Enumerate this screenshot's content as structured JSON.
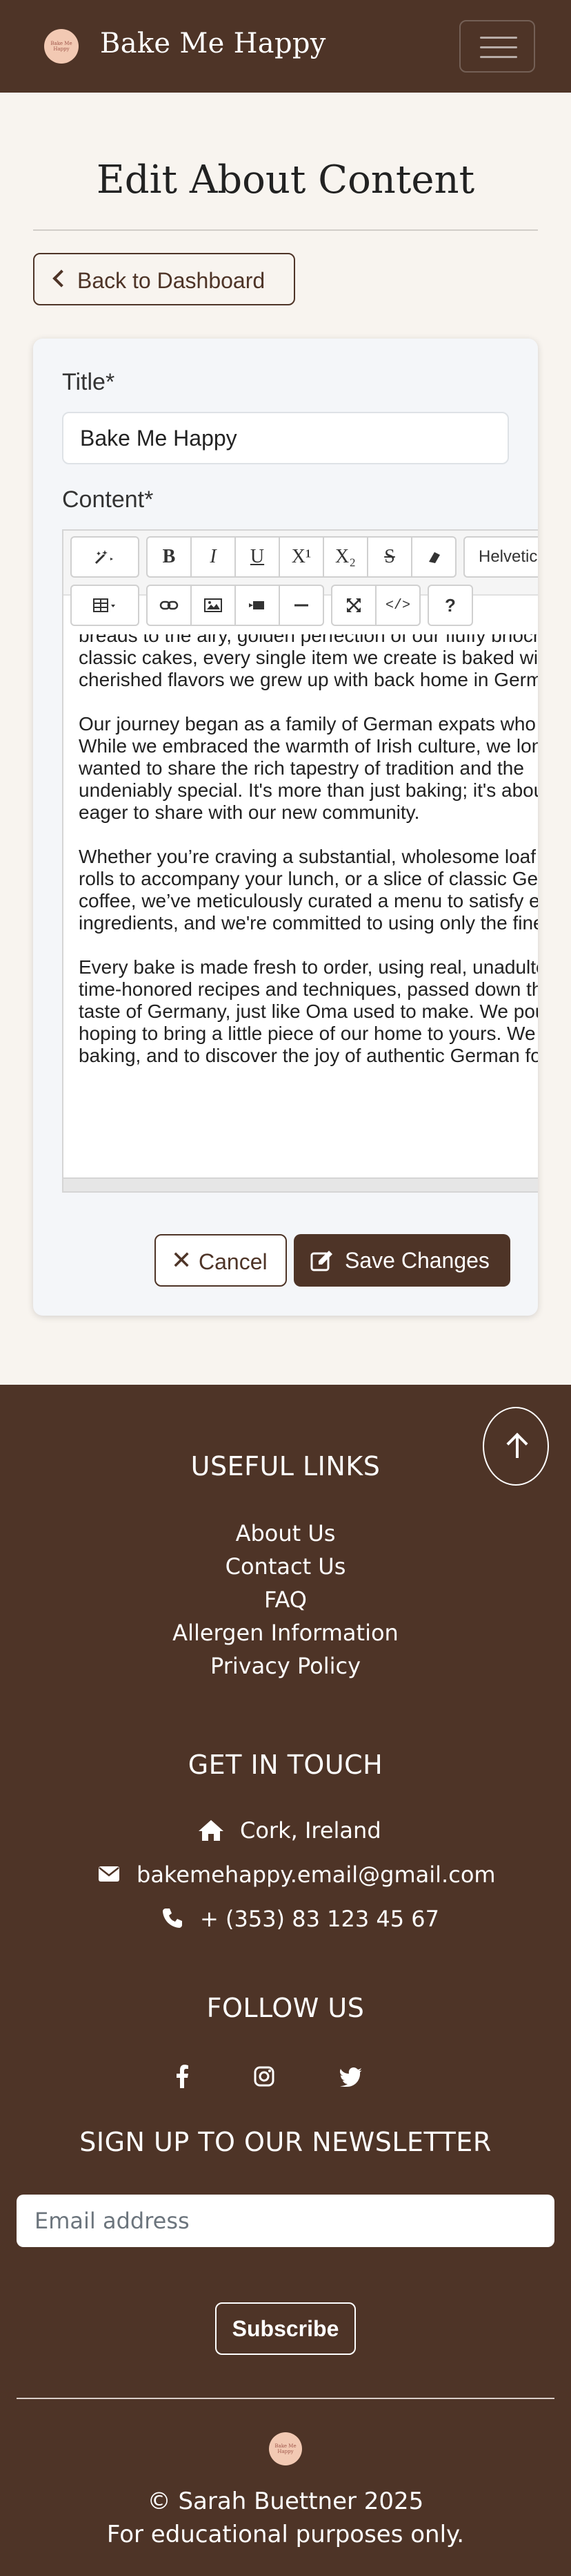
{
  "navbar": {
    "brand": "Bake Me Happy",
    "logo_text": "Bake Me Happy",
    "toggler_icon": "hamburger-icon"
  },
  "page": {
    "title": "Edit About Content",
    "back_label": "Back to Dashboard"
  },
  "form": {
    "title_label": "Title*",
    "title_value": "Bake Me Happy",
    "content_label": "Content*",
    "toolbar": {
      "row1": [
        "magic-icon",
        "B",
        "I",
        "U",
        "X¹",
        "X₂",
        "S",
        "eraser-icon"
      ],
      "font_value": "Helvetica",
      "row2": [
        "table-icon",
        "link-icon",
        "picture-icon",
        "video-icon",
        "hr-icon",
        "fullscreen-icon",
        "</>",
        "?"
      ]
    },
    "content_paragraphs": [
      [
        "breads to the airy, golden perfection of our fluffy brioche",
        "classic cakes, every single item we create is baked with",
        "cherished flavors we grew up with back home in Germany"
      ],
      [
        "Our journey began as a family of German expats who",
        "While we embraced the warmth of Irish culture, we longed",
        "wanted to share the rich tapestry of tradition and the",
        "undeniably special. It's more than just baking; it's about",
        "eager to share with our new community."
      ],
      [
        "Whether you’re craving a substantial, wholesome loaf",
        "rolls to accompany your lunch, or a slice of classic German",
        "coffee, we’ve meticulously curated a menu to satisfy every",
        "ingredients, and we're committed to using only the finest"
      ],
      [
        "Every bake is made fresh to order, using real, unadulterated",
        "time-honored recipes and techniques, passed down through",
        "taste of Germany, just like Oma used to make. We pour",
        "hoping to bring a little piece of our home to yours. We",
        "baking, and to discover the joy of authentic German food"
      ]
    ],
    "cancel_label": "Cancel",
    "save_label": "Save Changes"
  },
  "footer": {
    "useful_links_heading": "USEFUL LINKS",
    "links": [
      "About Us",
      "Contact Us",
      "FAQ",
      "Allergen Information",
      "Privacy Policy"
    ],
    "get_in_touch_heading": "GET IN TOUCH",
    "location": "Cork, Ireland",
    "email": "bakemehappy.email@gmail.com",
    "phone": "+ (353) 83 123 45 67",
    "follow_heading": "FOLLOW US",
    "social": [
      "facebook-icon",
      "instagram-icon",
      "twitter-icon"
    ],
    "newsletter_heading": "SIGN UP TO OUR NEWSLETTER",
    "email_placeholder": "Email address",
    "subscribe_label": "Subscribe",
    "copyright": "© Sarah Buettner 2025",
    "disclaimer": "For educational purposes only."
  },
  "colors": {
    "brand_brown": "#4e3427",
    "page_bg": "#f8f4ef",
    "logo_pink": "#f2c9b3"
  }
}
